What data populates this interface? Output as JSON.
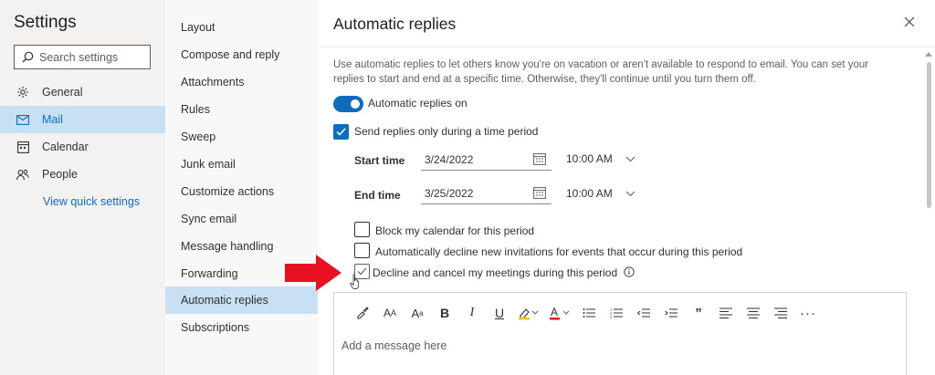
{
  "settings": {
    "title": "Settings",
    "search_placeholder": "Search settings",
    "categories": [
      {
        "label": "General",
        "icon": "gear-icon"
      },
      {
        "label": "Mail",
        "icon": "mail-icon"
      },
      {
        "label": "Calendar",
        "icon": "calendar-icon"
      },
      {
        "label": "People",
        "icon": "people-icon"
      }
    ],
    "quick_settings": "View quick settings"
  },
  "mail_menu": {
    "items": [
      "Layout",
      "Compose and reply",
      "Attachments",
      "Rules",
      "Sweep",
      "Junk email",
      "Customize actions",
      "Sync email",
      "Message handling",
      "Forwarding",
      "Automatic replies",
      "Subscriptions"
    ],
    "active": "Automatic replies"
  },
  "panel": {
    "title": "Automatic replies",
    "description": "Use automatic replies to let others know you're on vacation or aren't available to respond to email. You can set your replies to start and end at a specific time. Otherwise, they'll continue until you turn them off.",
    "toggle_label": "Automatic replies on",
    "time_period_label": "Send replies only during a time period",
    "start_label": "Start time",
    "start_date": "3/24/2022",
    "start_time": "10:00 AM",
    "end_label": "End time",
    "end_date": "3/25/2022",
    "end_time": "10:00 AM",
    "block_calendar": "Block my calendar for this period",
    "decline_invites": "Automatically decline new invitations for events that occur during this period",
    "cancel_meetings": "Decline and cancel my meetings during this period",
    "editor_placeholder": "Add a message here"
  },
  "colors": {
    "accent": "#0f6cbd",
    "selected_bg": "#c7e0f4",
    "arrow": "#e81123"
  }
}
